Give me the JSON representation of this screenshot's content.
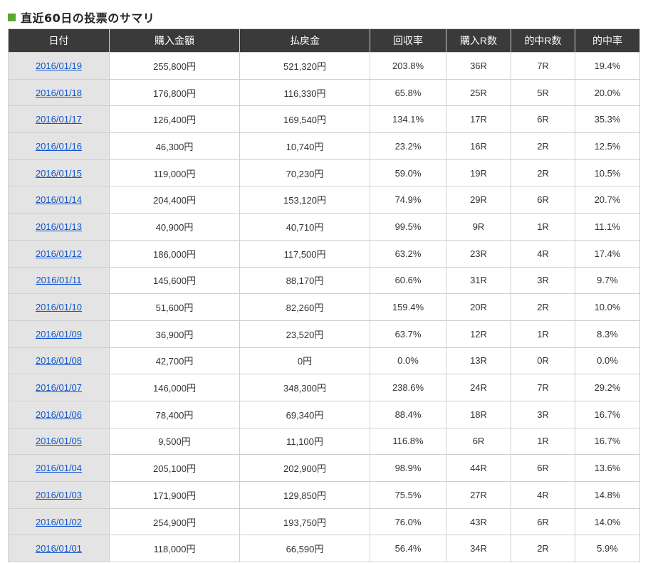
{
  "section": {
    "title": "直近60日の投票のサマリ",
    "accent_color": "#5aa832"
  },
  "table": {
    "headers": [
      "日付",
      "購入金額",
      "払戻金",
      "回収率",
      "購入R数",
      "的中R数",
      "的中率"
    ],
    "rows": [
      [
        "2016/01/19",
        "255,800円",
        "521,320円",
        "203.8%",
        "36R",
        "7R",
        "19.4%"
      ],
      [
        "2016/01/18",
        "176,800円",
        "116,330円",
        "65.8%",
        "25R",
        "5R",
        "20.0%"
      ],
      [
        "2016/01/17",
        "126,400円",
        "169,540円",
        "134.1%",
        "17R",
        "6R",
        "35.3%"
      ],
      [
        "2016/01/16",
        "46,300円",
        "10,740円",
        "23.2%",
        "16R",
        "2R",
        "12.5%"
      ],
      [
        "2016/01/15",
        "119,000円",
        "70,230円",
        "59.0%",
        "19R",
        "2R",
        "10.5%"
      ],
      [
        "2016/01/14",
        "204,400円",
        "153,120円",
        "74.9%",
        "29R",
        "6R",
        "20.7%"
      ],
      [
        "2016/01/13",
        "40,900円",
        "40,710円",
        "99.5%",
        "9R",
        "1R",
        "11.1%"
      ],
      [
        "2016/01/12",
        "186,000円",
        "117,500円",
        "63.2%",
        "23R",
        "4R",
        "17.4%"
      ],
      [
        "2016/01/11",
        "145,600円",
        "88,170円",
        "60.6%",
        "31R",
        "3R",
        "9.7%"
      ],
      [
        "2016/01/10",
        "51,600円",
        "82,260円",
        "159.4%",
        "20R",
        "2R",
        "10.0%"
      ],
      [
        "2016/01/09",
        "36,900円",
        "23,520円",
        "63.7%",
        "12R",
        "1R",
        "8.3%"
      ],
      [
        "2016/01/08",
        "42,700円",
        "0円",
        "0.0%",
        "13R",
        "0R",
        "0.0%"
      ],
      [
        "2016/01/07",
        "146,000円",
        "348,300円",
        "238.6%",
        "24R",
        "7R",
        "29.2%"
      ],
      [
        "2016/01/06",
        "78,400円",
        "69,340円",
        "88.4%",
        "18R",
        "3R",
        "16.7%"
      ],
      [
        "2016/01/05",
        "9,500円",
        "11,100円",
        "116.8%",
        "6R",
        "1R",
        "16.7%"
      ],
      [
        "2016/01/04",
        "205,100円",
        "202,900円",
        "98.9%",
        "44R",
        "6R",
        "13.6%"
      ],
      [
        "2016/01/03",
        "171,900円",
        "129,850円",
        "75.5%",
        "27R",
        "4R",
        "14.8%"
      ],
      [
        "2016/01/02",
        "254,900円",
        "193,750円",
        "76.0%",
        "43R",
        "6R",
        "14.0%"
      ],
      [
        "2016/01/01",
        "118,000円",
        "66,590円",
        "56.4%",
        "34R",
        "2R",
        "5.9%"
      ]
    ]
  },
  "colors": {
    "header_bg": "#3a3a3a",
    "date_cell_bg": "#e4e4e4",
    "link": "#1155cc",
    "border": "#cfcfcf"
  }
}
